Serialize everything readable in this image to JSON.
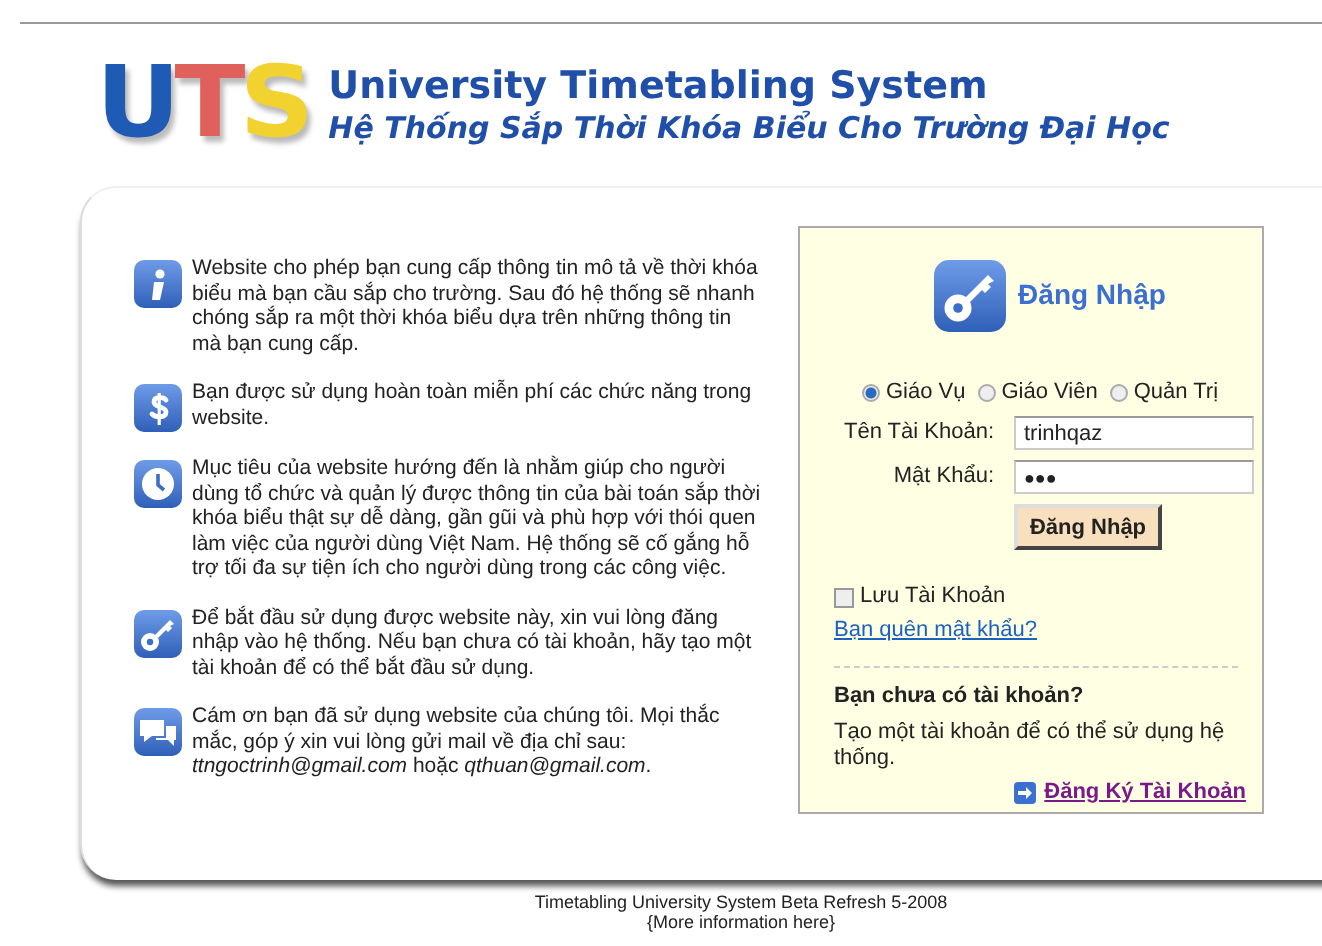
{
  "header": {
    "logo": "UTS",
    "title": "University Timetabling System",
    "subtitle": "Hệ Thống Sắp Thời Khóa Biểu Cho Trường Đại Học"
  },
  "info": [
    {
      "kind": "info",
      "text": "Website cho phép bạn cung cấp thông tin mô tả về thời khóa biểu mà bạn cầu sắp cho trường. Sau đó hệ thống sẽ nhanh chóng sắp ra một thời khóa biểu dựa trên những thông tin mà bạn cung cấp."
    },
    {
      "kind": "dollar",
      "text": "Bạn được sử dụng hoàn toàn miễn phí các chức năng trong website."
    },
    {
      "kind": "clock",
      "text": "Mục tiêu của website hướng đến là nhằm giúp cho người dùng tổ chức và quản lý được thông tin của bài toán sắp thời khóa biểu thật sự dễ dàng, gần gũi và phù hợp với thói quen làm việc của người dùng Việt Nam. Hệ thống sẽ cố gắng hỗ trợ tối đa sự tiện ích cho người dùng trong các công việc."
    },
    {
      "kind": "key",
      "text": "Để bắt đầu sử dụng được website này, xin vui lòng đăng nhập vào hệ thống. Nếu bạn chưa có tài khoản, hãy tạo một tài khoản để có thể bắt đầu sử dụng."
    },
    {
      "kind": "chat",
      "text": "Cám ơn bạn đã sử dụng website của chúng tôi. Mọi thắc mắc, góp ý xin vui lòng gửi mail về địa chỉ sau: *ttngoctrinh@gmail.com* hoặc *qthuan@gmail.com*."
    }
  ],
  "login": {
    "title": "Đăng Nhập",
    "roles": [
      {
        "label": "Giáo Vụ",
        "selected": true
      },
      {
        "label": "Giáo Viên",
        "selected": false
      },
      {
        "label": "Quản Trị",
        "selected": false
      }
    ],
    "username": {
      "label": "Tên Tài Khoản:",
      "value": "trinhqaz"
    },
    "password": {
      "label": "Mật Khẩu:",
      "value": "●●●"
    },
    "button": "Đăng Nhập",
    "remember": {
      "label": "Lưu Tài Khoản",
      "checked": false
    },
    "forgot_link": "Bạn quên mật khẩu?",
    "register": {
      "heading": "Bạn chưa có tài khoản?",
      "text": "Tạo một tài khoản để có thể sử dụng hệ thống.",
      "link": "Đăng Ký Tài Khoản"
    }
  },
  "footer": {
    "line": "Timetabling University System Beta Refresh 5-2008",
    "more": "{More information here}"
  }
}
